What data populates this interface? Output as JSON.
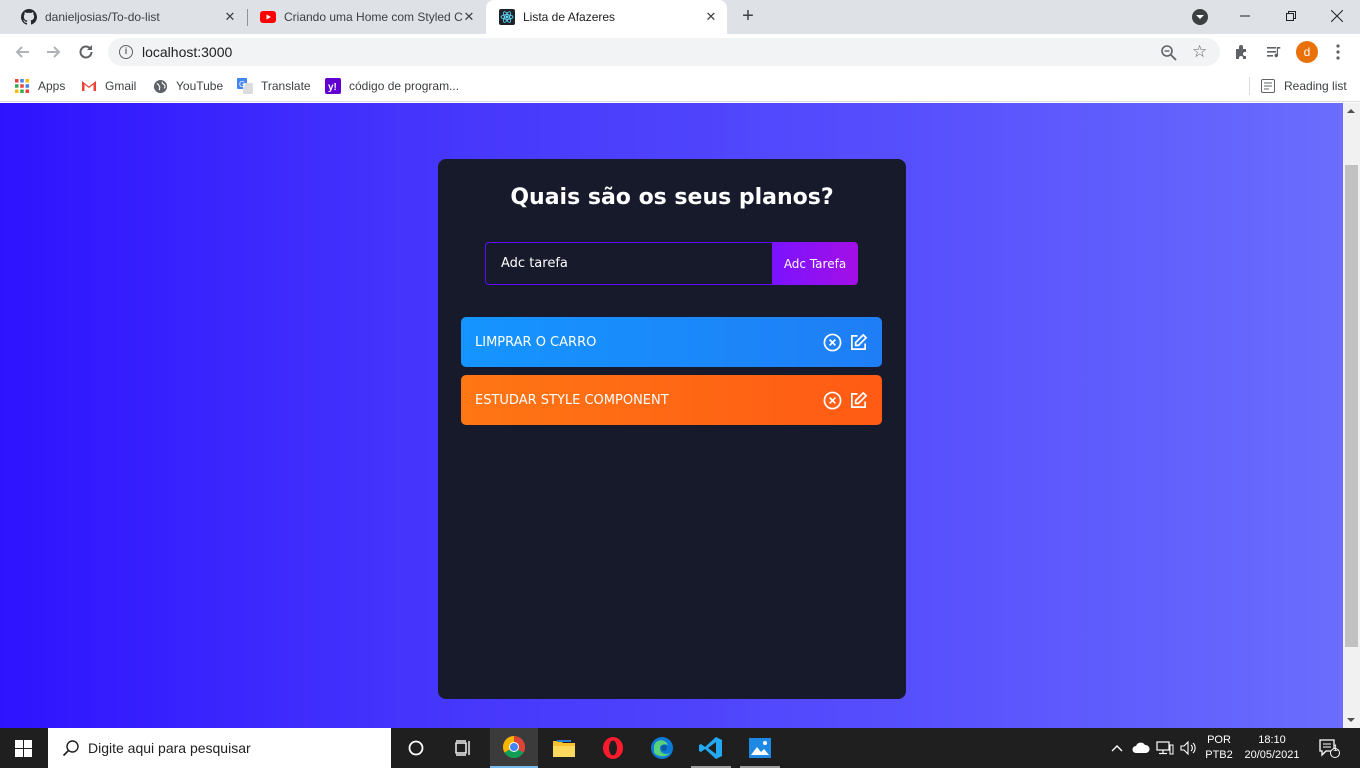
{
  "browser": {
    "tabs": [
      {
        "title": "danieljosias/To-do-list",
        "icon": "github-icon",
        "active": false
      },
      {
        "title": "Criando uma Home com Styled C",
        "icon": "youtube-icon",
        "active": false
      },
      {
        "title": "Lista de Afazeres",
        "icon": "react-icon",
        "active": true
      }
    ],
    "url": "localhost:3000",
    "profile_initial": "d"
  },
  "bookmarks": [
    {
      "label": "Apps",
      "icon": "apps-grid-icon"
    },
    {
      "label": "Gmail",
      "icon": "gmail-icon"
    },
    {
      "label": "YouTube",
      "icon": "globe-icon"
    },
    {
      "label": "Translate",
      "icon": "translate-icon"
    },
    {
      "label": "código de program...",
      "icon": "yahoo-icon"
    }
  ],
  "reading_list": "Reading list",
  "app": {
    "heading": "Quais são os seus planos?",
    "input_placeholder": "Adc tarefa",
    "add_button": "Adc Tarefa",
    "todos": [
      {
        "text": "LIMPRAR O CARRO",
        "color": "#1595ff"
      },
      {
        "text": "ESTUDAR STYLE COMPONENT",
        "color": "#ff7614"
      }
    ]
  },
  "taskbar": {
    "search_placeholder": "Digite aqui para pesquisar",
    "language": "POR",
    "layout": "PTB2",
    "time": "18:10",
    "date": "20/05/2021",
    "notifications": "1"
  }
}
